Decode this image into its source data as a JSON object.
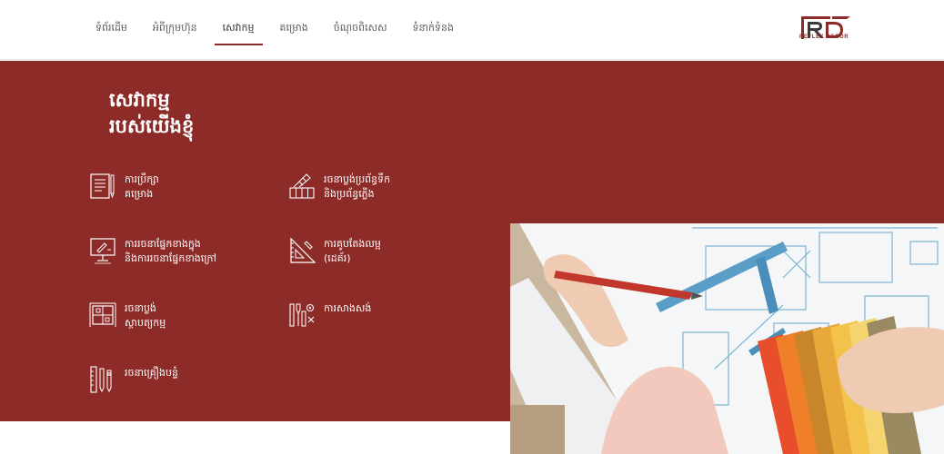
{
  "nav": {
    "items": [
      {
        "label": "ទំព័រដើម"
      },
      {
        "label": "អំពីក្រុមហ៊ុន"
      },
      {
        "label": "សេវាកម្ម"
      },
      {
        "label": "គម្រោង"
      },
      {
        "label": "ចំណុចពិសេស"
      },
      {
        "label": "ទំនាក់ទំនង"
      }
    ],
    "active_index": 2
  },
  "logo": {
    "letters": "RD",
    "text": "REFLEX DECOR"
  },
  "hero": {
    "title_line1": "សេវាកម្ម",
    "title_line2": "របស់យើងខ្ញុំ"
  },
  "services": [
    {
      "label": "ការប្រឹក្សា\nគម្រោង",
      "icon": "document-pen-icon"
    },
    {
      "label": "រចនាប្លង់ប្រព័ន្ធទឹក\nនិងប្រព័ន្ធភ្លើង",
      "icon": "color-swatch-grid-icon"
    },
    {
      "label": "ការរចនាផ្នែកខាងក្នុង\nនិងការរចនាផ្នែកខាងក្រៅ",
      "icon": "monitor-design-icon"
    },
    {
      "label": "ការគូបតែងលម្អ\n(ដេគ័រ)",
      "icon": "ruler-triangle-icon"
    },
    {
      "label": "រចនាប្លង់\nស្ថាបត្យកម្ម",
      "icon": "blueprint-frame-icon"
    },
    {
      "label": "ការសាងសង់",
      "icon": "tools-gear-icon"
    },
    {
      "label": "រចនាគ្រឿងបន្ទំ",
      "icon": "ruler-pencils-icon"
    }
  ],
  "colors": {
    "brand": "#8c2b28",
    "accent": "#8b2a27"
  }
}
